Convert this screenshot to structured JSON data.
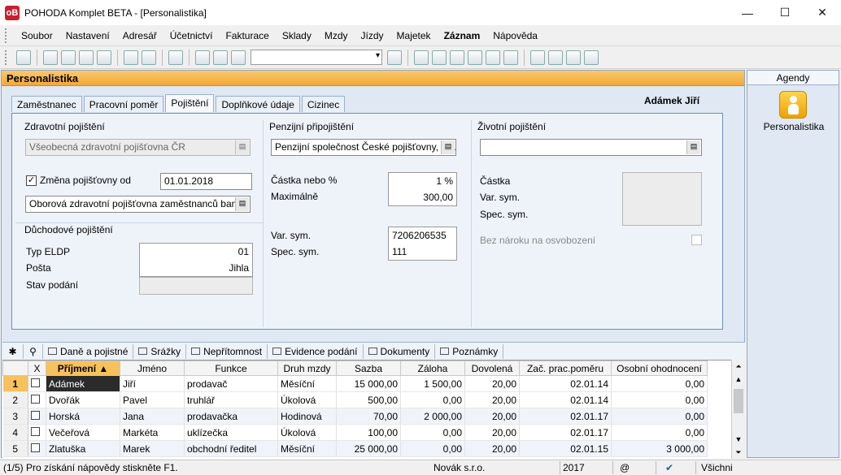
{
  "window": {
    "title": "POHODA Komplet BETA - [Personalistika]",
    "logo": "oB"
  },
  "menu": [
    "Soubor",
    "Nastavení",
    "Adresář",
    "Účetnictví",
    "Fakturace",
    "Sklady",
    "Mzdy",
    "Jízdy",
    "Majetek",
    "Záznam",
    "Nápověda"
  ],
  "panel": {
    "title": "Personalistika",
    "person": "Adámek Jiří"
  },
  "tabs": [
    "Zaměstnanec",
    "Pracovní poměr",
    "Pojištění",
    "Doplňkové údaje",
    "Cizinec"
  ],
  "form": {
    "health": {
      "section": "Zdravotní pojištění",
      "insurer": "Všeobecná zdravotní pojišťovna ČR",
      "change_label": "Změna pojišťovny od",
      "change_checked": true,
      "change_date": "01.01.2018",
      "new_insurer": "Oborová zdravotní pojišťovna zaměstnanců ban"
    },
    "pension": {
      "section": "Důchodové pojištění",
      "type_label": "Typ ELDP",
      "type_value": "01",
      "office_label": "Pošta",
      "office_value": "Jihla",
      "status_label": "Stav podání",
      "status_value": ""
    },
    "supplementary": {
      "section": "Penzijní připojištění",
      "company": "Penzijní společnost České pojišťovny, a.s.",
      "amount_label": "Částka nebo %",
      "amount_value": "1 %",
      "max_label": "Maximálně",
      "max_value": "300,00",
      "var_label": "Var. sym.",
      "var_value": "7206206535",
      "spec_label": "Spec. sym.",
      "spec_value": "111"
    },
    "life": {
      "section": "Životní pojištění",
      "company": "",
      "amount_label": "Částka",
      "var_label": "Var. sym.",
      "spec_label": "Spec. sym.",
      "exempt_label": "Bez nároku na osvobození"
    }
  },
  "bottom_tabs": [
    "Daně a pojistné",
    "Srážky",
    "Nepřítomnost",
    "Evidence podání",
    "Dokumenty",
    "Poznámky"
  ],
  "grid": {
    "headers": [
      "X",
      "Příjmení",
      "Jméno",
      "Funkce",
      "Druh mzdy",
      "Sazba",
      "Záloha",
      "Dovolená",
      "Zač. prac.poměru",
      "Osobní ohodnocení"
    ],
    "rows": [
      [
        "1",
        "Adámek",
        "Jiří",
        "prodavač",
        "Měsíční",
        "15 000,00",
        "1 500,00",
        "20,00",
        "02.01.14",
        "0,00"
      ],
      [
        "2",
        "Dvořák",
        "Pavel",
        "truhlář",
        "Úkolová",
        "500,00",
        "0,00",
        "20,00",
        "02.01.14",
        "0,00"
      ],
      [
        "3",
        "Horská",
        "Jana",
        "prodavačka",
        "Hodinová",
        "70,00",
        "2 000,00",
        "20,00",
        "02.01.17",
        "0,00"
      ],
      [
        "4",
        "Večeřová",
        "Markéta",
        "uklízečka",
        "Úkolová",
        "100,00",
        "0,00",
        "20,00",
        "02.01.17",
        "0,00"
      ],
      [
        "5",
        "Zlatuška",
        "Marek",
        "obchodní ředitel",
        "Měsíční",
        "25 000,00",
        "0,00",
        "20,00",
        "02.01.15",
        "3 000,00"
      ]
    ]
  },
  "agendy": {
    "header": "Agendy",
    "item": "Personalistika"
  },
  "status": {
    "hint": "(1/5) Pro získání nápovědy stiskněte F1.",
    "company": "Novák s.r.o.",
    "year": "2017",
    "at": "@",
    "filter": "Všichni"
  }
}
